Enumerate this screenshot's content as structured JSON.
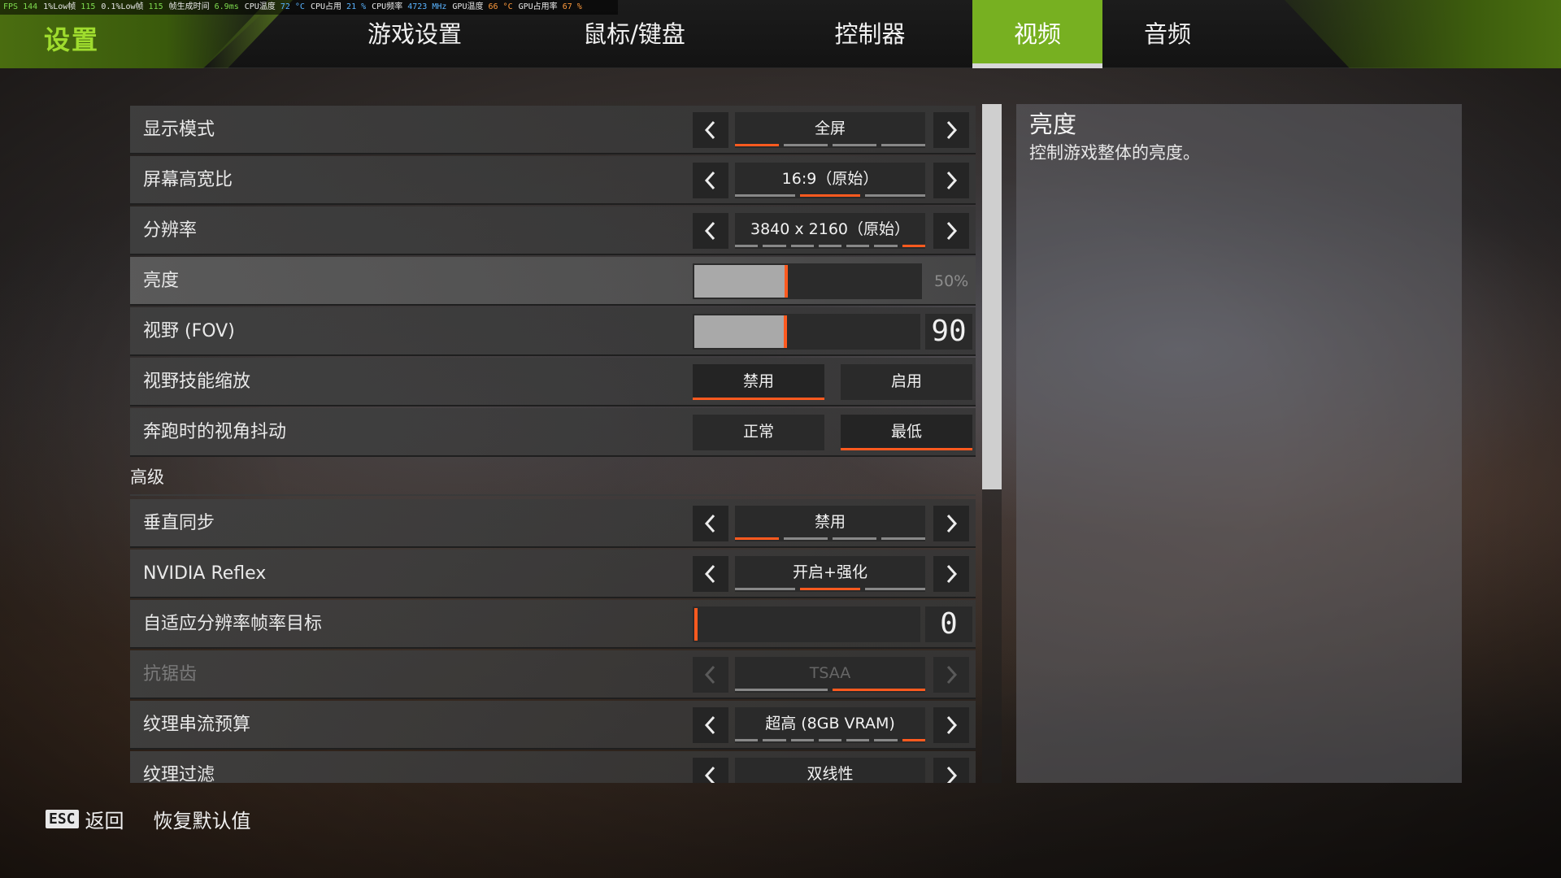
{
  "perf": {
    "fps_label": "FPS",
    "fps": "144",
    "low1_label": "1%Low帧",
    "low1": "115",
    "low01_label": "0.1%Low帧",
    "low01": "115",
    "frametime_label": "帧生成时间",
    "frametime": "6.9ms",
    "cpu_temp_label": "CPU温度",
    "cpu_temp": "72 °C",
    "cpu_use_label": "CPU占用",
    "cpu_use": "21 %",
    "cpu_freq_label": "CPU频率",
    "cpu_freq": "4723 MHz",
    "gpu_temp_label": "GPU温度",
    "gpu_temp": "66 °C",
    "gpu_use_label": "GPU占用率",
    "gpu_use": "67 %"
  },
  "header": {
    "title": "设置",
    "tabs": [
      {
        "label": "游戏设置"
      },
      {
        "label": "鼠标/键盘"
      },
      {
        "label": "控制器"
      },
      {
        "label": "视频",
        "active": true
      },
      {
        "label": "音频"
      }
    ]
  },
  "settings": {
    "display_mode": {
      "label": "显示模式",
      "value": "全屏",
      "segments": 4,
      "selected": 1
    },
    "aspect_ratio": {
      "label": "屏幕高宽比",
      "value": "16:9（原始）",
      "segments": 3,
      "selected": 2
    },
    "resolution": {
      "label": "分辨率",
      "value": "3840 x 2160（原始）",
      "segments": 7,
      "selected": 7
    },
    "brightness": {
      "label": "亮度",
      "value_text": "50%",
      "level": 0.5
    },
    "fov": {
      "label": "视野 (FOV)",
      "value": "90",
      "level": 0.5
    },
    "fov_ability_scaling": {
      "label": "视野技能缩放",
      "options": [
        "禁用",
        "启用"
      ],
      "selected": 0
    },
    "sprint_view_shake": {
      "label": "奔跑时的视角抖动",
      "options": [
        "正常",
        "最低"
      ],
      "selected": 1
    },
    "advanced_label": "高级",
    "vsync": {
      "label": "垂直同步",
      "value": "禁用",
      "segments": 4,
      "selected": 1
    },
    "nvidia_reflex": {
      "label": "NVIDIA Reflex",
      "value": "开启+强化",
      "segments": 3,
      "selected": 2
    },
    "adaptive_res": {
      "label": "自适应分辨率帧率目标",
      "value": "0",
      "level": 0
    },
    "anti_aliasing": {
      "label": "抗锯齿",
      "value": "TSAA",
      "segments": 2,
      "selected": 2,
      "disabled": true
    },
    "texture_budget": {
      "label": "纹理串流预算",
      "value": "超高 (8GB VRAM)",
      "segments": 7,
      "selected": 7
    },
    "texture_filter": {
      "label": "纹理过滤",
      "value": "双线性"
    }
  },
  "description": {
    "title": "亮度",
    "text": "控制游戏整体的亮度。"
  },
  "footer": {
    "esc_key": "ESC",
    "back_label": "返回",
    "restore_label": "恢复默认值"
  },
  "colors": {
    "accent_green": "#77b021",
    "accent_orange": "#ff5a1f",
    "title_green": "#9fdc2e"
  }
}
